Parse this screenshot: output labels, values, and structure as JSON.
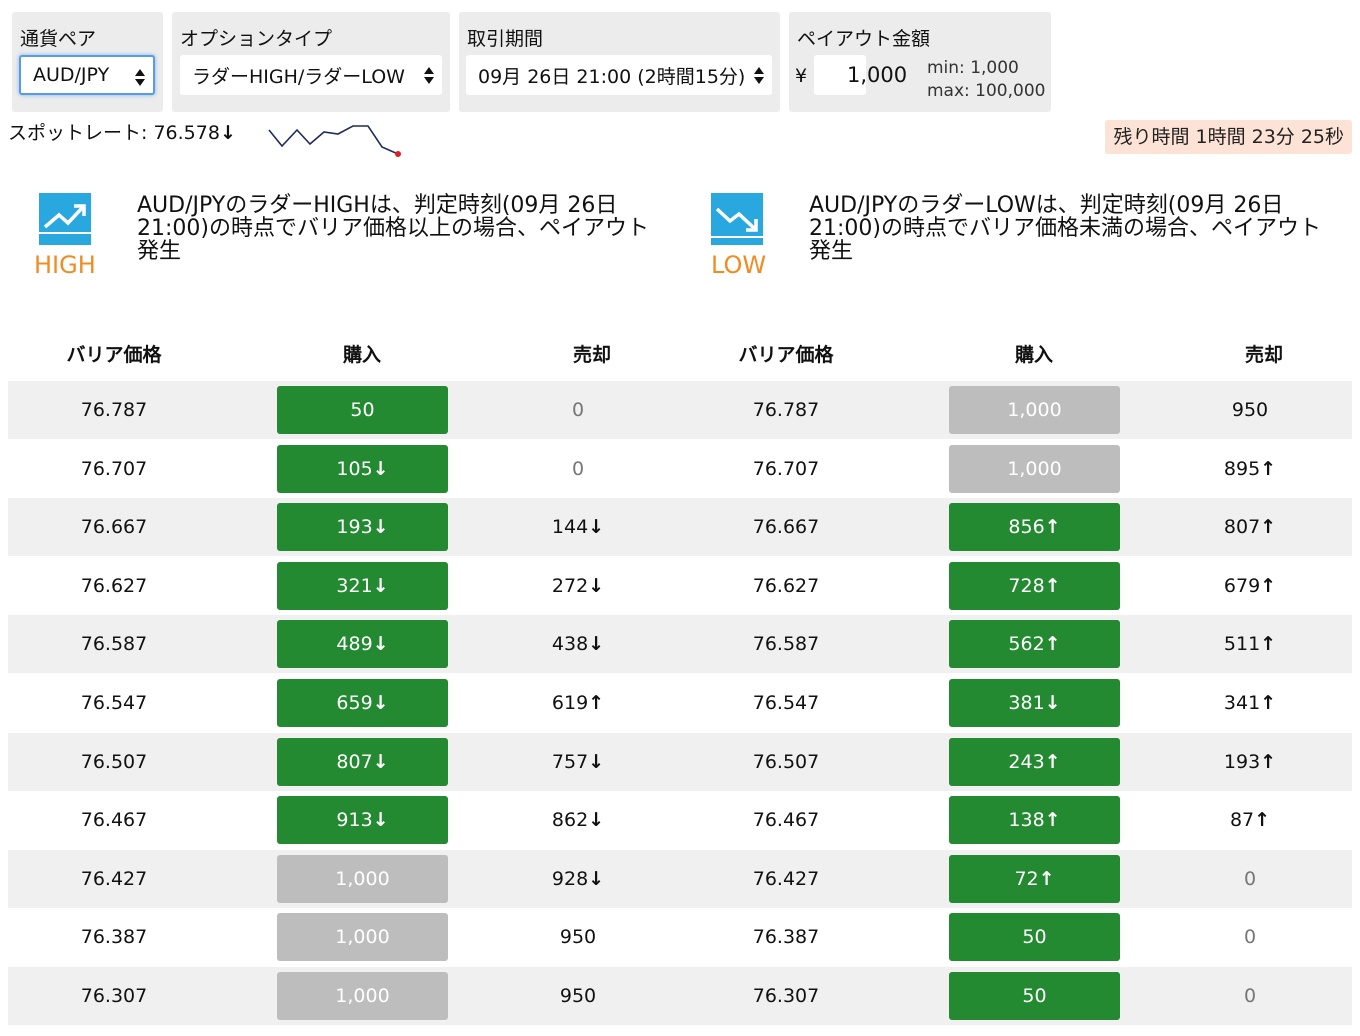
{
  "controls": {
    "pair": {
      "label": "通貨ペア",
      "value": "AUD/JPY"
    },
    "option_type": {
      "label": "オプションタイプ",
      "value": "ラダーHIGH/ラダーLOW"
    },
    "period": {
      "label": "取引期間",
      "value": "09月 26日 21:00 (2時間15分)"
    },
    "payout": {
      "label": "ペイアウト金額",
      "currency": "¥",
      "value": "1,000",
      "min": "min: 1,000",
      "max": "max: 100,000"
    }
  },
  "spot": {
    "text": "スポットレート: 76.578",
    "arrow": "↓"
  },
  "remaining": "残り時間 1時間 23分 25秒",
  "high": {
    "word": "HIGH",
    "desc": "AUD/JPYのラダーHIGHは、判定時刻(09月 26日 21:00)の時点でバリア価格以上の場合、ペイアウト発生"
  },
  "low": {
    "word": "LOW",
    "desc": "AUD/JPYのラダーLOWは、判定時刻(09月 26日 21:00)の時点でバリア価格未満の場合、ペイアウト発生"
  },
  "headers": {
    "barrier": "バリア価格",
    "buy": "購入",
    "sell": "売却"
  },
  "colors": {
    "buy_green": "#238a32",
    "disabled_gray": "#bdbdbd",
    "accent_orange": "#f08c22",
    "icon_blue": "#29a8e0"
  },
  "high_rows": [
    {
      "barrier": "76.787",
      "buy": "50",
      "buy_arrow": "",
      "buy_enabled": true,
      "sell": "0",
      "sell_arrow": "",
      "sell_muted": true
    },
    {
      "barrier": "76.707",
      "buy": "105",
      "buy_arrow": "↓",
      "buy_enabled": true,
      "sell": "0",
      "sell_arrow": "",
      "sell_muted": true
    },
    {
      "barrier": "76.667",
      "buy": "193",
      "buy_arrow": "↓",
      "buy_enabled": true,
      "sell": "144",
      "sell_arrow": "↓",
      "sell_muted": false
    },
    {
      "barrier": "76.627",
      "buy": "321",
      "buy_arrow": "↓",
      "buy_enabled": true,
      "sell": "272",
      "sell_arrow": "↓",
      "sell_muted": false
    },
    {
      "barrier": "76.587",
      "buy": "489",
      "buy_arrow": "↓",
      "buy_enabled": true,
      "sell": "438",
      "sell_arrow": "↓",
      "sell_muted": false
    },
    {
      "barrier": "76.547",
      "buy": "659",
      "buy_arrow": "↓",
      "buy_enabled": true,
      "sell": "619",
      "sell_arrow": "↑",
      "sell_muted": false
    },
    {
      "barrier": "76.507",
      "buy": "807",
      "buy_arrow": "↓",
      "buy_enabled": true,
      "sell": "757",
      "sell_arrow": "↓",
      "sell_muted": false
    },
    {
      "barrier": "76.467",
      "buy": "913",
      "buy_arrow": "↓",
      "buy_enabled": true,
      "sell": "862",
      "sell_arrow": "↓",
      "sell_muted": false
    },
    {
      "barrier": "76.427",
      "buy": "1,000",
      "buy_arrow": "",
      "buy_enabled": false,
      "sell": "928",
      "sell_arrow": "↓",
      "sell_muted": false
    },
    {
      "barrier": "76.387",
      "buy": "1,000",
      "buy_arrow": "",
      "buy_enabled": false,
      "sell": "950",
      "sell_arrow": "",
      "sell_muted": false
    },
    {
      "barrier": "76.307",
      "buy": "1,000",
      "buy_arrow": "",
      "buy_enabled": false,
      "sell": "950",
      "sell_arrow": "",
      "sell_muted": false
    }
  ],
  "low_rows": [
    {
      "barrier": "76.787",
      "buy": "1,000",
      "buy_arrow": "",
      "buy_enabled": false,
      "sell": "950",
      "sell_arrow": "",
      "sell_muted": false
    },
    {
      "barrier": "76.707",
      "buy": "1,000",
      "buy_arrow": "",
      "buy_enabled": false,
      "sell": "895",
      "sell_arrow": "↑",
      "sell_muted": false
    },
    {
      "barrier": "76.667",
      "buy": "856",
      "buy_arrow": "↑",
      "buy_enabled": true,
      "sell": "807",
      "sell_arrow": "↑",
      "sell_muted": false
    },
    {
      "barrier": "76.627",
      "buy": "728",
      "buy_arrow": "↑",
      "buy_enabled": true,
      "sell": "679",
      "sell_arrow": "↑",
      "sell_muted": false
    },
    {
      "barrier": "76.587",
      "buy": "562",
      "buy_arrow": "↑",
      "buy_enabled": true,
      "sell": "511",
      "sell_arrow": "↑",
      "sell_muted": false
    },
    {
      "barrier": "76.547",
      "buy": "381",
      "buy_arrow": "↓",
      "buy_enabled": true,
      "sell": "341",
      "sell_arrow": "↑",
      "sell_muted": false
    },
    {
      "barrier": "76.507",
      "buy": "243",
      "buy_arrow": "↑",
      "buy_enabled": true,
      "sell": "193",
      "sell_arrow": "↑",
      "sell_muted": false
    },
    {
      "barrier": "76.467",
      "buy": "138",
      "buy_arrow": "↑",
      "buy_enabled": true,
      "sell": "87",
      "sell_arrow": "↑",
      "sell_muted": false
    },
    {
      "barrier": "76.427",
      "buy": "72",
      "buy_arrow": "↑",
      "buy_enabled": true,
      "sell": "0",
      "sell_arrow": "",
      "sell_muted": true
    },
    {
      "barrier": "76.387",
      "buy": "50",
      "buy_arrow": "",
      "buy_enabled": true,
      "sell": "0",
      "sell_arrow": "",
      "sell_muted": true
    },
    {
      "barrier": "76.307",
      "buy": "50",
      "buy_arrow": "",
      "buy_enabled": true,
      "sell": "0",
      "sell_arrow": "",
      "sell_muted": true
    }
  ]
}
